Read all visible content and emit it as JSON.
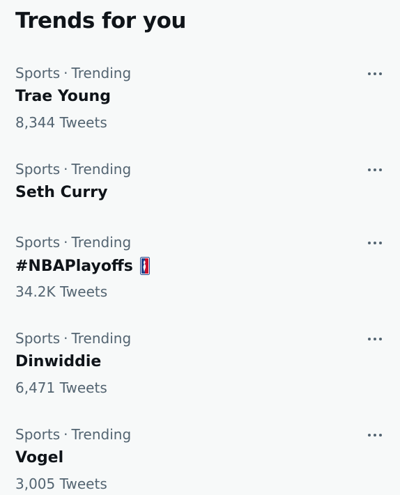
{
  "header": {
    "title": "Trends for you"
  },
  "trends": [
    {
      "category": "Sports",
      "separator": "·",
      "status": "Trending",
      "name": "Trae Young",
      "count": "8,344 Tweets"
    },
    {
      "category": "Sports",
      "separator": "·",
      "status": "Trending",
      "name": "Seth Curry",
      "count": ""
    },
    {
      "category": "Sports",
      "separator": "·",
      "status": "Trending",
      "name": "#NBAPlayoffs",
      "count": "34.2K Tweets",
      "icon": "nba-logo-icon"
    },
    {
      "category": "Sports",
      "separator": "·",
      "status": "Trending",
      "name": "Dinwiddie",
      "count": "6,471 Tweets"
    },
    {
      "category": "Sports",
      "separator": "·",
      "status": "Trending",
      "name": "Vogel",
      "count": "3,005 Tweets"
    }
  ],
  "icons": {
    "more": "more-horizontal-icon"
  },
  "colors": {
    "background": "#f7f9f9",
    "primary_text": "#0f1419",
    "secondary_text": "#536471",
    "nba_blue": "#1d428a",
    "nba_red": "#c8102e"
  }
}
